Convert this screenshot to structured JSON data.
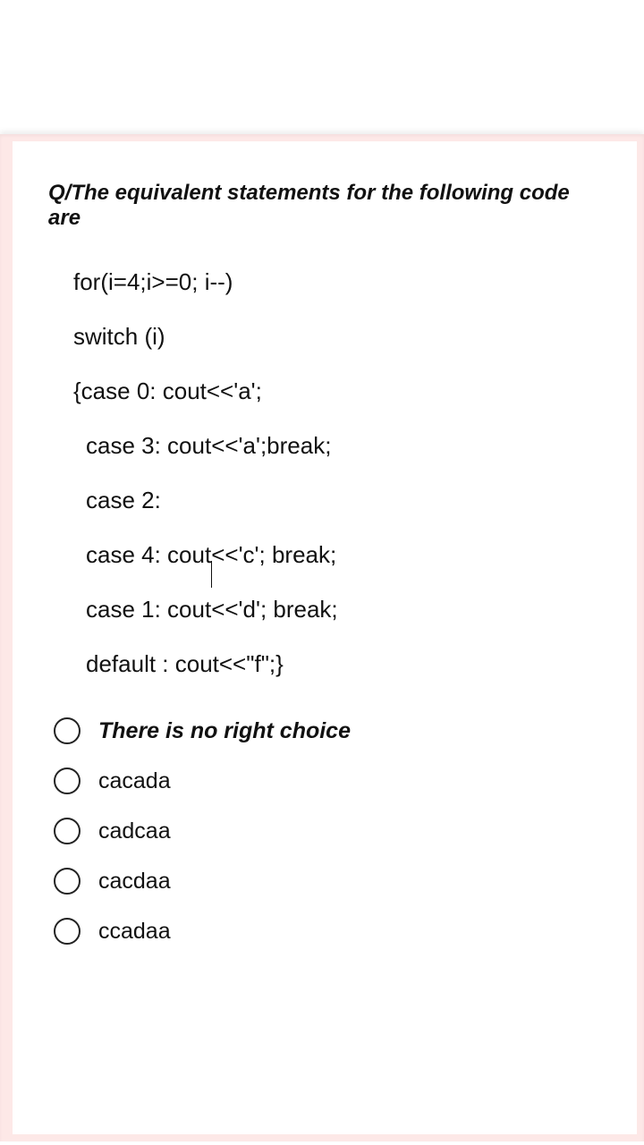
{
  "question": "Q/The equivalent statements for the following code are",
  "code": {
    "line1": "for(i=4;i>=0; i--)",
    "line2": "switch (i)",
    "line3": "{case 0: cout<<'a';",
    "line4": "case 3: cout<<'a';break;",
    "line5": "case 2:",
    "line6_a": "case 4: cout",
    "line6_b": "<<'c'; break;",
    "line7": "case 1: cout<<'d'; break;",
    "line8": "default : cout<<\"f\";}"
  },
  "options": [
    {
      "label": "There is no right choice",
      "bold": true
    },
    {
      "label": "cacada",
      "bold": false
    },
    {
      "label": "cadcaa",
      "bold": false
    },
    {
      "label": "cacdaa",
      "bold": false
    },
    {
      "label": "ccadaa",
      "bold": false
    }
  ]
}
